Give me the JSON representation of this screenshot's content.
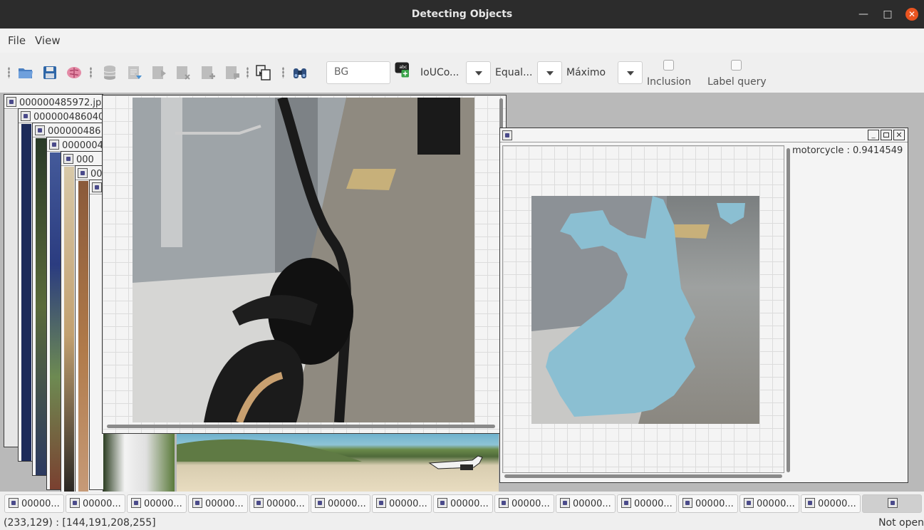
{
  "window": {
    "title": "Detecting Objects"
  },
  "menu": {
    "file": "File",
    "view": "View"
  },
  "toolbar": {
    "icons": [
      "open-folder-icon",
      "save-icon",
      "brain-icon",
      "database-icon",
      "add-image-icon",
      "next-image-icon",
      "remove-image-icon",
      "add-item-icon",
      "comment-icon",
      "copy-icon",
      "binoculars-icon",
      "add-label-icon"
    ],
    "bg_field": "BG",
    "metric_label": "IoUCo...",
    "comparison_label": "Equal...",
    "aggregation_label": "Máximo",
    "inclusion_label": "Inclusion",
    "inclusion_checked": false,
    "label_query_label": "Label query",
    "label_query_checked": false
  },
  "cascade_windows": [
    {
      "title": "000000485972.jp"
    },
    {
      "title": "000000486040"
    },
    {
      "title": "000000486"
    },
    {
      "title": "0000004"
    },
    {
      "title": "000"
    },
    {
      "title": "00"
    }
  ],
  "result_window": {
    "detection_label": "motorcycle : 0.9414549",
    "mask_color": "#8bbfd2"
  },
  "taskbar": {
    "items": [
      "00000...",
      "00000...",
      "00000...",
      "00000...",
      "00000...",
      "00000...",
      "00000...",
      "00000...",
      "00000...",
      "00000...",
      "00000...",
      "00000...",
      "00000...",
      "00000..."
    ]
  },
  "status": {
    "pixel_info": "(233,129) : [144,191,208,255]",
    "right": "Not open"
  }
}
